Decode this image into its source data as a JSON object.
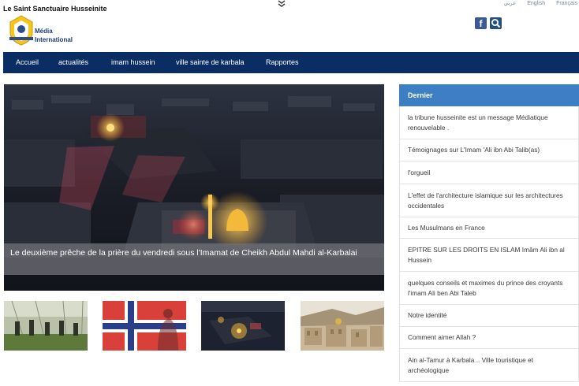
{
  "site": {
    "name": "Le Saint Sanctuaire Husseinite",
    "logo_text_line1": "Média",
    "logo_text_line2": "International"
  },
  "languages": [
    "عربي",
    "English",
    "Français"
  ],
  "icons": {
    "facebook": "facebook-icon",
    "search": "search-icon",
    "scroll": "chevron-double-down-icon"
  },
  "nav": {
    "items": [
      {
        "label": "Accueil"
      },
      {
        "label": "actualités"
      },
      {
        "label": "imam hussein"
      },
      {
        "label": "ville sainte de karbala"
      },
      {
        "label": "Rapportes"
      }
    ]
  },
  "hero": {
    "caption": "Le deuxième prêche de la prière du vendredi sous l'Imamat de Cheikh Abdul Mahdi al-Karbalai"
  },
  "sidebar": {
    "header": "Dernier",
    "items": [
      {
        "label": "la tribune husseinite est un message Médiatique renouvelable ."
      },
      {
        "label": "Témoignages sur L'Imam 'Ali ibn Abi Talib(as)"
      },
      {
        "label": "l'orgueil"
      },
      {
        "label": "L'effet de l'architecture islamique sur les architectures occidentales"
      },
      {
        "label": "Les Musulmans en France"
      },
      {
        "label": "EPITRE SUR LES DROITS EN ISLAM Imâm Ali ibn al Hussein"
      },
      {
        "label": "quelques conseils et maximes du prince des croyants l'imam Ali ben Abi Taleb"
      },
      {
        "label": "Notre identité"
      },
      {
        "label": "Comment aimer Allah ?"
      },
      {
        "label": "Ain al-Tamur à Karbala .. Ville touristique et archéologique"
      }
    ]
  },
  "colors": {
    "nav_bg": "#0a2e63",
    "sidebar_header_bg": "#3c7fc4",
    "facebook": "#3b5998"
  }
}
